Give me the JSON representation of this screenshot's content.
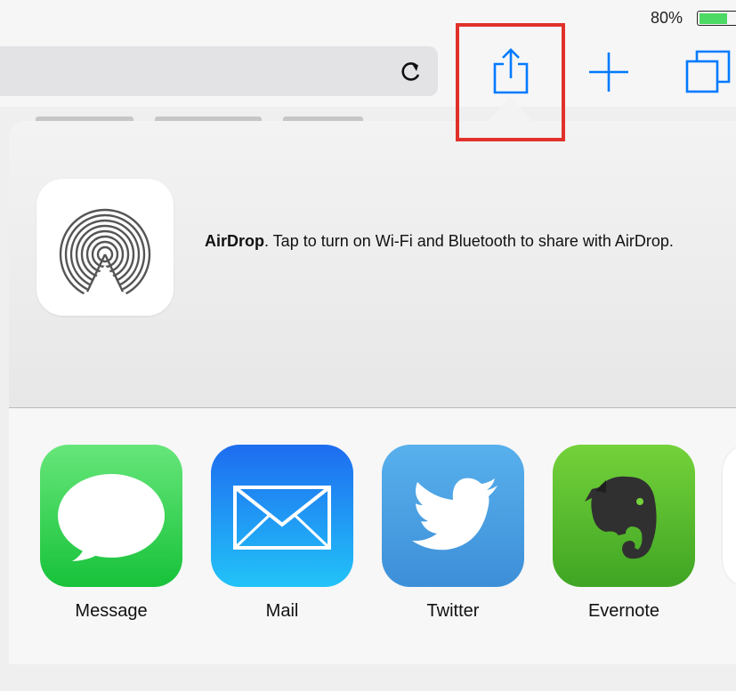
{
  "status": {
    "battery_percent": "80%",
    "battery_level": 0.8,
    "battery_color": "#4cd964"
  },
  "toolbar": {
    "reload_icon": "reload-icon",
    "share_icon": "share-icon",
    "new_tab_icon": "plus-icon",
    "tabs_icon": "tabs-icon",
    "icon_color": "#007aff",
    "highlight_color": "#e0312a"
  },
  "airdrop": {
    "title": "AirDrop",
    "description": ". Tap to turn on Wi-Fi and Bluetooth to share with AirDrop.",
    "icon": "airdrop-icon"
  },
  "apps": [
    {
      "label": "Message",
      "icon": "message-icon",
      "color": "#4cd964"
    },
    {
      "label": "Mail",
      "icon": "mail-icon",
      "color": "#1d8bf2"
    },
    {
      "label": "Twitter",
      "icon": "twitter-icon",
      "color": "#4aa3ea"
    },
    {
      "label": "Evernote",
      "icon": "evernote-icon",
      "color": "#5dbb32"
    }
  ]
}
